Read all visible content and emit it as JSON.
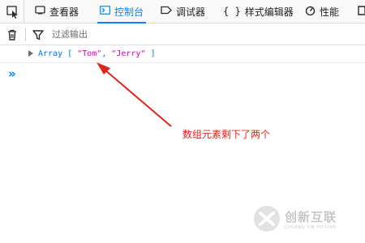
{
  "toolbar": {
    "tabs": [
      {
        "label": "查看器",
        "icon": "inspector-icon"
      },
      {
        "label": "控制台",
        "icon": "console-icon",
        "selected": true
      },
      {
        "label": "调试器",
        "icon": "debugger-icon"
      },
      {
        "label": "样式编辑器",
        "icon": "style-editor-icon"
      },
      {
        "label": "性能",
        "icon": "performance-icon"
      }
    ]
  },
  "filter": {
    "placeholder": "过滤输出"
  },
  "console": {
    "output": {
      "type": "Array",
      "open_bracket": "[",
      "items": [
        "\"Tom\"",
        "\"Jerry\""
      ],
      "separator": ",",
      "close_bracket": "]"
    },
    "prompt": "»"
  },
  "annotation": {
    "text": "数组元素剩下了两个",
    "color": "#e0251b"
  },
  "watermark": {
    "text_cn": "创新互联",
    "text_en": "CHUANG XIN HU LIAN"
  },
  "colors": {
    "accent": "#0a84ff",
    "string": "#dd00a9",
    "object": "#0074e8"
  }
}
